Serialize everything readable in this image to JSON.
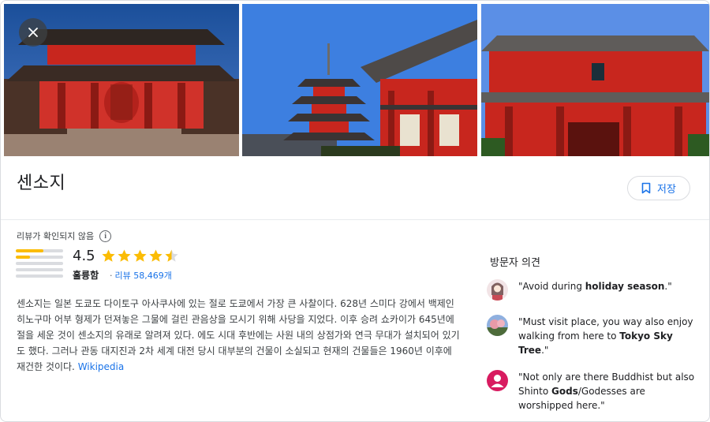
{
  "place": {
    "title": "센소지",
    "save_label": "저장"
  },
  "rating": {
    "unverified_label": "리뷰가 확인되지 않음",
    "score": "4.5",
    "stars": 4.5,
    "rating_word": "훌륭함",
    "separator": "·",
    "reviews_label": "리뷰 58,469개",
    "distribution": [
      0.58,
      0.3,
      0.0,
      0.0,
      0.0
    ]
  },
  "description": {
    "text": "센소지는 일본 도쿄도 다이토구 아사쿠사에 있는 절로 도쿄에서 가장 큰 사찰이다. 628년 스미다 강에서 백제인 히노구마 어부 형제가 던져놓은 그물에 걸린 관음상을 모시기 위해 사당을 지었다. 이후 승려 쇼카이가 645년에 절을 세운 것이 센소지의 유래로 알려져 있다. 에도 시대 후반에는 사원 내의 상점가와 연극 무대가 설치되어 있기도 했다. 그러나 관동 대지진과 2차 세계 대전 당시 대부분의 건물이 소실되고 현재의 건물들은 1960년 이후에 재건한 것이다. ",
    "link_label": "Wikipedia"
  },
  "opinions": {
    "title": "방문자 의견",
    "items": [
      {
        "pre": "\"Avoid during ",
        "bold": "holiday season",
        "post": ".\"",
        "pre2": "",
        "bold2": "",
        "post2": ""
      },
      {
        "pre": "\"Must visit place, you way also enjoy walking from here to ",
        "bold": "Tokyo Sky Tree",
        "post": ".\"",
        "pre2": "",
        "bold2": "",
        "post2": ""
      },
      {
        "pre": "\"Not only are there Buddhist but also Shinto ",
        "bold": "Gods",
        "post": "/Godesses are worshipped here.\"",
        "pre2": "",
        "bold2": "",
        "post2": ""
      }
    ]
  },
  "colors": {
    "accent": "#1a73e8",
    "star": "#fbbc04",
    "temple_red": "#c8261e"
  },
  "icons": {
    "close": "close-icon",
    "save": "bookmark-icon",
    "info": "info-icon",
    "star": "star-icon"
  }
}
